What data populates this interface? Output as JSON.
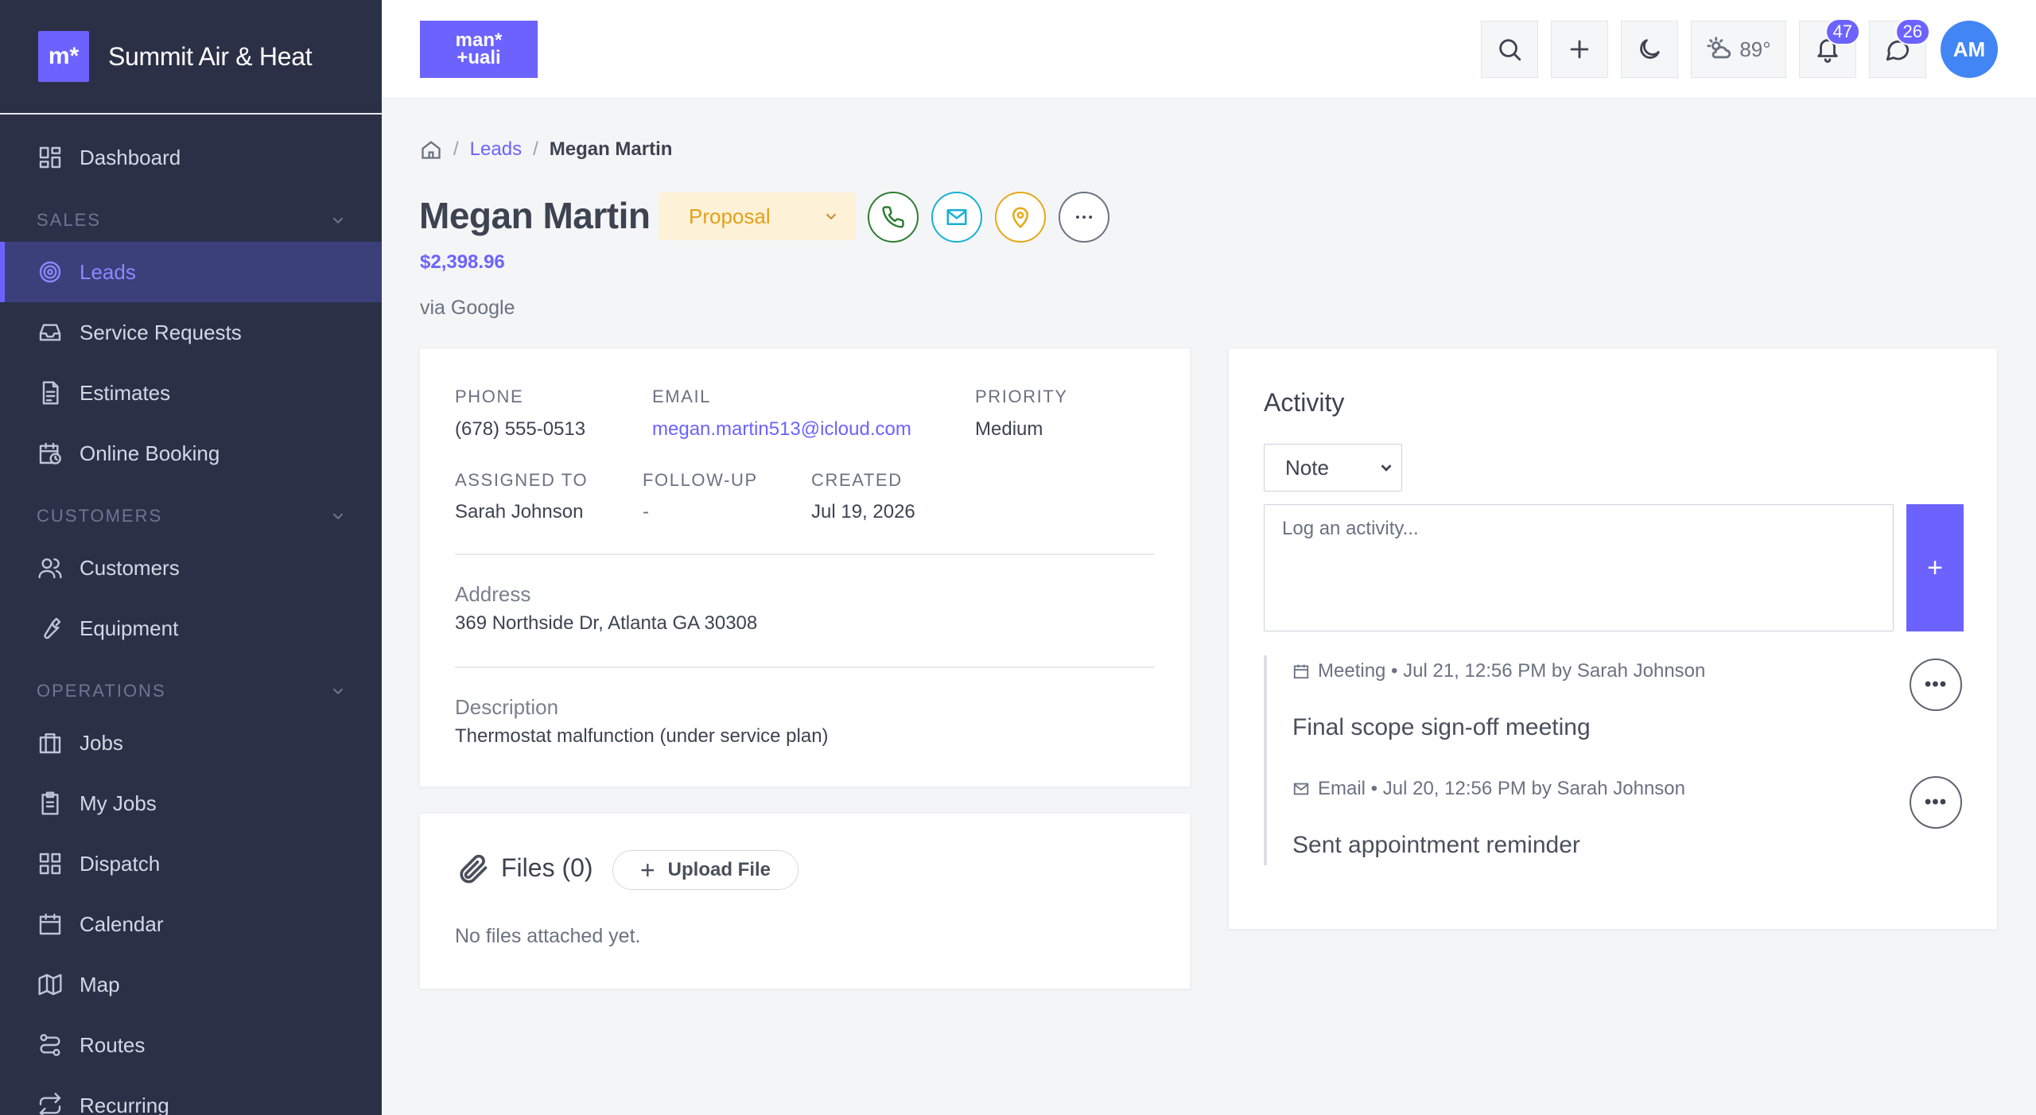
{
  "brand": {
    "logo": "m*",
    "name": "Summit Air & Heat"
  },
  "sidebar": {
    "items": [
      {
        "label": "Dashboard",
        "icon": "dashboard-icon"
      },
      {
        "section": "SALES"
      },
      {
        "label": "Leads",
        "icon": "target-icon",
        "active": true
      },
      {
        "label": "Service Requests",
        "icon": "inbox-icon"
      },
      {
        "label": "Estimates",
        "icon": "document-icon"
      },
      {
        "label": "Online Booking",
        "icon": "calendar-clock-icon"
      },
      {
        "section": "CUSTOMERS"
      },
      {
        "label": "Customers",
        "icon": "users-icon"
      },
      {
        "label": "Equipment",
        "icon": "wrench-icon"
      },
      {
        "section": "OPERATIONS"
      },
      {
        "label": "Jobs",
        "icon": "briefcase-icon"
      },
      {
        "label": "My Jobs",
        "icon": "clipboard-icon"
      },
      {
        "label": "Dispatch",
        "icon": "grid-icon"
      },
      {
        "label": "Calendar",
        "icon": "calendar-icon"
      },
      {
        "label": "Map",
        "icon": "map-icon"
      },
      {
        "label": "Routes",
        "icon": "route-icon"
      },
      {
        "label": "Recurring",
        "icon": "repeat-icon"
      }
    ]
  },
  "topbar": {
    "app_logo": "man*\n+uali",
    "weather": "89°",
    "notifications_count": "47",
    "messages_count": "26",
    "avatar_initials": "AM"
  },
  "breadcrumb": {
    "parent": "Leads",
    "current": "Megan Martin"
  },
  "lead": {
    "name": "Megan Martin",
    "stage": "Proposal",
    "value": "$2,398.96",
    "source": "via Google",
    "accent_color": "#6c63ff"
  },
  "details": {
    "phone_label": "PHONE",
    "phone": "(678) 555-0513",
    "email_label": "EMAIL",
    "email": "megan.martin513@icloud.com",
    "priority_label": "PRIORITY",
    "priority": "Medium",
    "assigned_label": "ASSIGNED TO",
    "assigned": "Sarah Johnson",
    "followup_label": "FOLLOW-UP",
    "followup": "-",
    "created_label": "CREATED",
    "created": "Jul 19, 2026",
    "address_label": "Address",
    "address": "369 Northside Dr, Atlanta GA 30308",
    "description_label": "Description",
    "description": "Thermostat malfunction (under service plan)"
  },
  "files": {
    "title": "Files (0)",
    "upload_label": "Upload File",
    "empty_text": "No files attached yet."
  },
  "activity": {
    "title": "Activity",
    "type_selected": "Note",
    "input_placeholder": "Log an activity...",
    "add_label": "+",
    "entries": [
      {
        "meta": "Meeting • Jul 21, 12:56 PM by Sarah Johnson",
        "text": "Final scope sign-off meeting",
        "icon": "calendar-icon"
      },
      {
        "meta": "Email • Jul 20, 12:56 PM by Sarah Johnson",
        "text": "Sent appointment reminder",
        "icon": "mail-icon"
      }
    ]
  }
}
